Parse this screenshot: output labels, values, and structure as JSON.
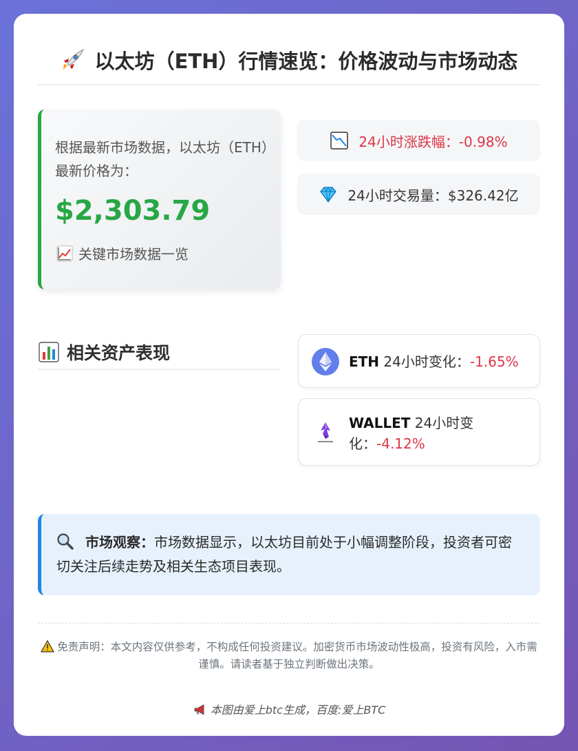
{
  "header": {
    "title": "以太坊（ETH）行情速览：价格波动与市场动态",
    "icon": "rocket-icon"
  },
  "price_card": {
    "intro": "根据最新市场数据，以太坊（ETH）最新价格为：",
    "price": "$2,303.79",
    "key_data_label": "关键市场数据一览",
    "accent_color": "#28a745"
  },
  "stats": {
    "change_24h": "24小时涨跌幅：-0.98%",
    "volume_24h": "24小时交易量：$326.42亿"
  },
  "related": {
    "title": "相关资产表现",
    "assets": [
      {
        "symbol": "ETH",
        "label": "24小时变化：",
        "value": "-1.65%",
        "logo": "ethereum-logo"
      },
      {
        "symbol": "WALLET",
        "label": "24小时变化：",
        "value": "-4.12%",
        "logo": "ambire-wallet-logo"
      }
    ]
  },
  "insight": {
    "label": "市场观察：",
    "text": "市场数据显示，以太坊目前处于小幅调整阶段，投资者可密切关注后续走势及相关生态项目表现。",
    "accent_color": "#1e88e5"
  },
  "disclaimer": "免责声明：本文内容仅供参考，不构成任何投资建议。加密货币市场波动性极高，投资有风险，入市需谨慎。请读者基于独立判断做出决策。",
  "footer": "本图由爱上btc生成，百度:爱上BTC",
  "colors": {
    "negative": "#dc3545",
    "positive": "#28a745"
  }
}
